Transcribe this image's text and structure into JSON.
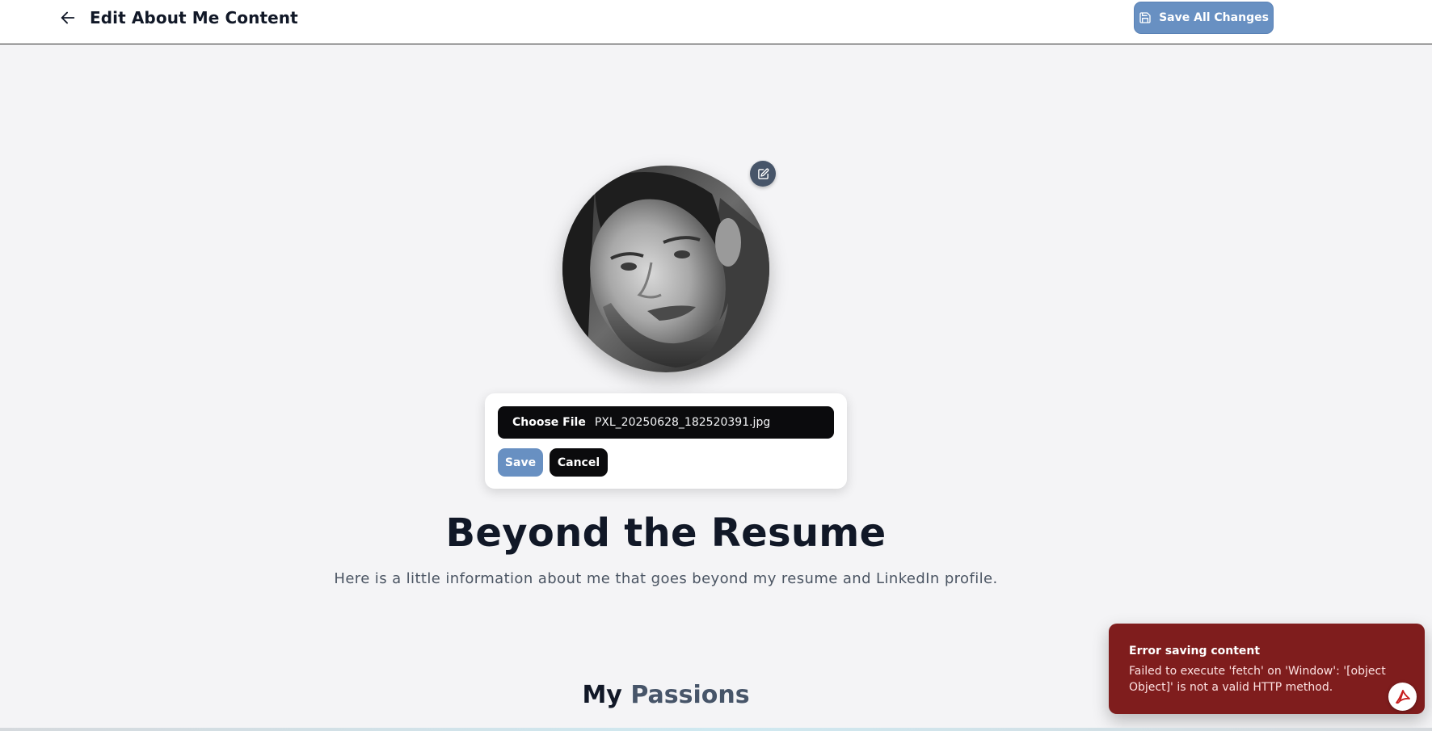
{
  "header": {
    "title": "Edit About Me Content",
    "back_icon": "arrow-left-icon",
    "save_all_label": "Save All Changes",
    "save_icon": "floppy-disk-icon"
  },
  "profile": {
    "photo_alt": "Profile photo",
    "edit_icon": "pencil-square-icon"
  },
  "upload": {
    "choose_file_label": "Choose File",
    "file_name": "PXL_20250628_182520391.jpg",
    "save_label": "Save",
    "cancel_label": "Cancel"
  },
  "hero": {
    "title": "Beyond the Resume",
    "subtitle": "Here is a little information about me that goes beyond my resume and LinkedIn profile."
  },
  "section": {
    "heading_prefix": "My",
    "heading_accent": "Passions"
  },
  "toast": {
    "title": "Error saving content",
    "message": "Failed to execute 'fetch' on 'Window': '[object Object]' is not a valid HTTP method."
  },
  "colors": {
    "primary": "#6890c2",
    "dark": "#0b0b0d",
    "error": "#7f1d1d",
    "accent_text": "#475569",
    "background": "#f4f4f6"
  },
  "icons": {
    "pdf": "pdf-icon"
  }
}
